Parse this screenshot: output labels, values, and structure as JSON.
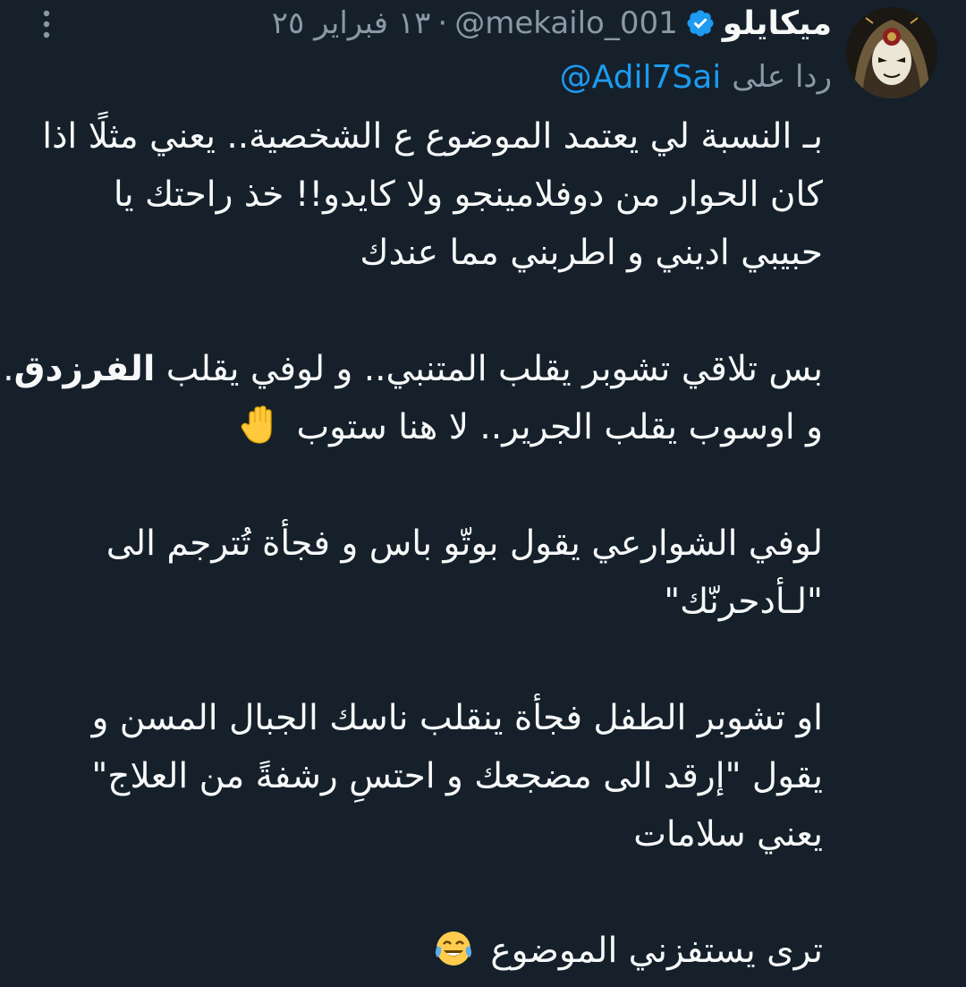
{
  "author": {
    "display_name": "ميكايلو",
    "handle": "@mekailo_001",
    "separator": "·",
    "date": "١٣ فبراير ٢٥",
    "avatar_icon": "masked-character-avatar",
    "verified_icon": "verified-badge-icon",
    "verified_color": "#1d9bf0"
  },
  "reply": {
    "label": "ردا على",
    "handle": "@Adil7Sai",
    "link_color": "#1d9bf0"
  },
  "menu_icon": "more-vertical-icon",
  "body": {
    "p1_l1": "بـ النسبة لي يعتمد الموضوع ع الشخصية.. يعني مثلًا اذا",
    "p1_l2": "كان الحوار من دوفلامينجو ولا كايدو!! خذ راحتك يا",
    "p1_l3": "حبيبي اديني و اطربني مما عندك",
    "p2_l1_a": "بس تلاقي تشوبر يقلب المتنبي.. و لوفي يقلب",
    "p2_l1_bold": "الفرزدق",
    "p2_l1_b": "..",
    "p2_l2": "و اوسوب يقلب الجرير.. لا هنا ستوب",
    "p3_l1": "لوفي الشوارعي يقول بوتّو باس و فجأة تُترجم الى",
    "p3_l2": "\"لـأدحرنّك\"",
    "p4_l1": "او تشوبر الطفل فجأة ينقلب ناسك الجبال المسن و",
    "p4_l2": "يقول \"إرقد الى مضجعك و احتسِ رشفةً من العلاج\"",
    "p4_l3": "يعني سلامات",
    "p5_l1": "ترى يستفزني الموضوع",
    "emoji_hand": "raised-hand-emoji",
    "emoji_laugh": "tears-of-joy-emoji"
  },
  "colors": {
    "background": "#15202b",
    "text": "#f7f9f9",
    "secondary_text": "#8b98a5"
  }
}
